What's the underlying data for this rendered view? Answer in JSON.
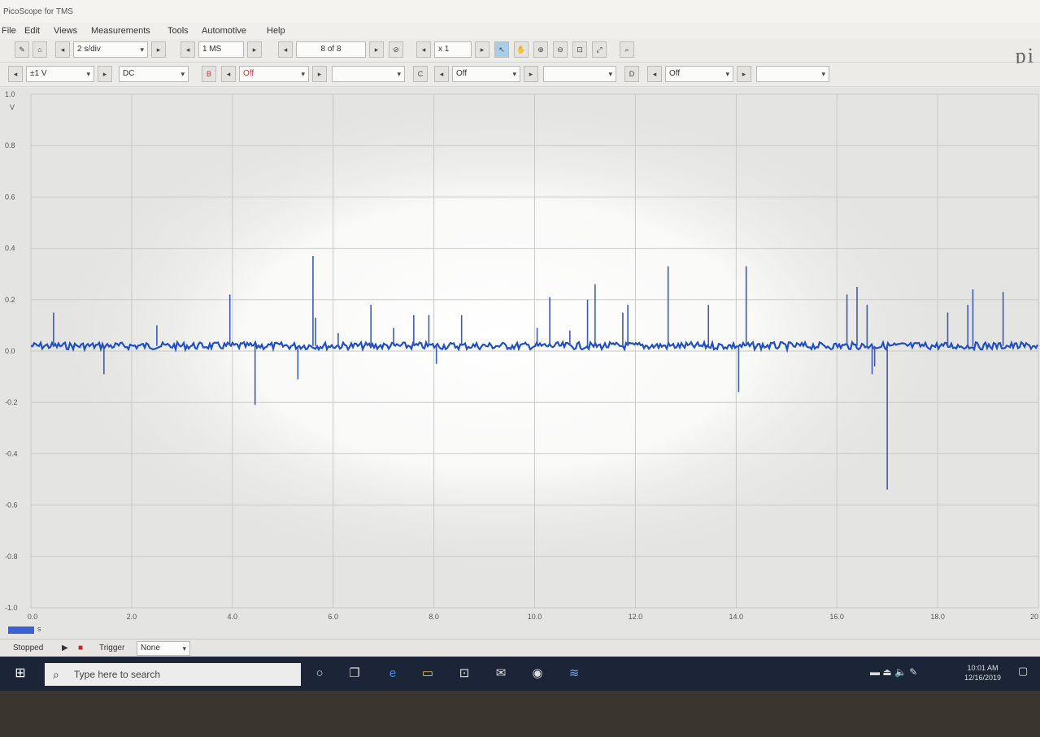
{
  "window": {
    "title": "PicoScope for TMS"
  },
  "menu": [
    "File",
    "Edit",
    "Views",
    "Measurements",
    "Tools",
    "Automotive",
    "Help"
  ],
  "toolbar1": {
    "timebase": "2 s/div",
    "samples": "1 MS",
    "buffer": "8 of 8",
    "zoom": "x 1"
  },
  "toolbar2": {
    "channel_a_range": "±1 V",
    "channel_a_coupling": "DC",
    "channel_b_label": "B",
    "channel_b_state": "Off",
    "channel_c_label": "C",
    "channel_c_state": "Off",
    "channel_d_label": "D",
    "channel_d_state": "Off"
  },
  "brand": "pi",
  "chart_data": {
    "type": "line",
    "xlim": [
      0,
      20
    ],
    "ylim": [
      -1.0,
      1.0
    ],
    "yunit": "V",
    "xunit": "s",
    "x_ticks": [
      "0.0",
      "2.0",
      "4.0",
      "6.0",
      "8.0",
      "10.0",
      "12.0",
      "14.0",
      "16.0",
      "18.0",
      "20"
    ],
    "y_ticks": [
      "1.0",
      "0.8",
      "0.6",
      "0.4",
      "0.2",
      "0.0",
      "-0.2",
      "-0.4",
      "-0.6",
      "-0.8",
      "-1.0"
    ],
    "grid": true,
    "baseline": 0.02,
    "series_color": "#1f4fc8",
    "spikes": [
      {
        "x": 0.45,
        "y": 0.15
      },
      {
        "x": 1.45,
        "y": -0.09
      },
      {
        "x": 2.5,
        "y": 0.1
      },
      {
        "x": 3.95,
        "y": 0.22
      },
      {
        "x": 4.45,
        "y": -0.21
      },
      {
        "x": 5.3,
        "y": -0.11
      },
      {
        "x": 5.6,
        "y": 0.37
      },
      {
        "x": 5.65,
        "y": 0.13
      },
      {
        "x": 6.1,
        "y": 0.07
      },
      {
        "x": 6.75,
        "y": 0.18
      },
      {
        "x": 7.2,
        "y": 0.09
      },
      {
        "x": 7.6,
        "y": 0.14
      },
      {
        "x": 7.9,
        "y": 0.14
      },
      {
        "x": 8.05,
        "y": -0.05
      },
      {
        "x": 8.55,
        "y": 0.14
      },
      {
        "x": 10.05,
        "y": 0.09
      },
      {
        "x": 10.3,
        "y": 0.21
      },
      {
        "x": 10.7,
        "y": 0.08
      },
      {
        "x": 11.05,
        "y": 0.2
      },
      {
        "x": 11.2,
        "y": 0.26
      },
      {
        "x": 11.75,
        "y": 0.15
      },
      {
        "x": 11.85,
        "y": 0.18
      },
      {
        "x": 12.65,
        "y": 0.33
      },
      {
        "x": 13.45,
        "y": 0.18
      },
      {
        "x": 14.05,
        "y": -0.16
      },
      {
        "x": 14.2,
        "y": 0.33
      },
      {
        "x": 16.2,
        "y": 0.22
      },
      {
        "x": 16.4,
        "y": 0.25
      },
      {
        "x": 16.6,
        "y": 0.18
      },
      {
        "x": 16.7,
        "y": -0.09
      },
      {
        "x": 16.75,
        "y": -0.06
      },
      {
        "x": 17.0,
        "y": -0.54
      },
      {
        "x": 18.2,
        "y": 0.15
      },
      {
        "x": 18.6,
        "y": 0.18
      },
      {
        "x": 18.7,
        "y": 0.24
      },
      {
        "x": 19.3,
        "y": 0.23
      }
    ]
  },
  "status": {
    "state": "Stopped",
    "trigger_label": "Trigger",
    "trigger_value": "None"
  },
  "taskbar": {
    "search_placeholder": "Type here to search",
    "time": "10:01 AM",
    "date": "12/16/2019"
  }
}
